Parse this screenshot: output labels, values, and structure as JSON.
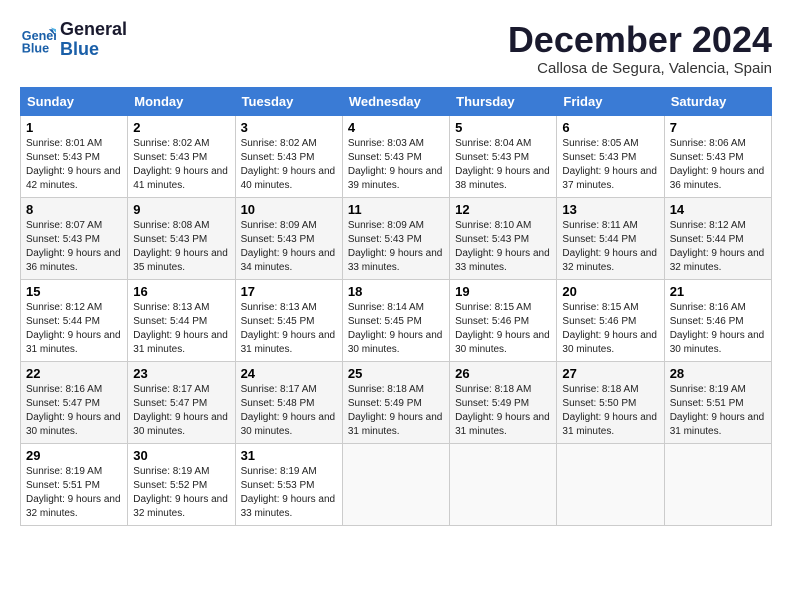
{
  "header": {
    "logo_line1": "General",
    "logo_line2": "Blue",
    "month": "December 2024",
    "location": "Callosa de Segura, Valencia, Spain"
  },
  "weekdays": [
    "Sunday",
    "Monday",
    "Tuesday",
    "Wednesday",
    "Thursday",
    "Friday",
    "Saturday"
  ],
  "weeks": [
    [
      {
        "day": "1",
        "sunrise": "Sunrise: 8:01 AM",
        "sunset": "Sunset: 5:43 PM",
        "daylight": "Daylight: 9 hours and 42 minutes."
      },
      {
        "day": "2",
        "sunrise": "Sunrise: 8:02 AM",
        "sunset": "Sunset: 5:43 PM",
        "daylight": "Daylight: 9 hours and 41 minutes."
      },
      {
        "day": "3",
        "sunrise": "Sunrise: 8:02 AM",
        "sunset": "Sunset: 5:43 PM",
        "daylight": "Daylight: 9 hours and 40 minutes."
      },
      {
        "day": "4",
        "sunrise": "Sunrise: 8:03 AM",
        "sunset": "Sunset: 5:43 PM",
        "daylight": "Daylight: 9 hours and 39 minutes."
      },
      {
        "day": "5",
        "sunrise": "Sunrise: 8:04 AM",
        "sunset": "Sunset: 5:43 PM",
        "daylight": "Daylight: 9 hours and 38 minutes."
      },
      {
        "day": "6",
        "sunrise": "Sunrise: 8:05 AM",
        "sunset": "Sunset: 5:43 PM",
        "daylight": "Daylight: 9 hours and 37 minutes."
      },
      {
        "day": "7",
        "sunrise": "Sunrise: 8:06 AM",
        "sunset": "Sunset: 5:43 PM",
        "daylight": "Daylight: 9 hours and 36 minutes."
      }
    ],
    [
      {
        "day": "8",
        "sunrise": "Sunrise: 8:07 AM",
        "sunset": "Sunset: 5:43 PM",
        "daylight": "Daylight: 9 hours and 36 minutes."
      },
      {
        "day": "9",
        "sunrise": "Sunrise: 8:08 AM",
        "sunset": "Sunset: 5:43 PM",
        "daylight": "Daylight: 9 hours and 35 minutes."
      },
      {
        "day": "10",
        "sunrise": "Sunrise: 8:09 AM",
        "sunset": "Sunset: 5:43 PM",
        "daylight": "Daylight: 9 hours and 34 minutes."
      },
      {
        "day": "11",
        "sunrise": "Sunrise: 8:09 AM",
        "sunset": "Sunset: 5:43 PM",
        "daylight": "Daylight: 9 hours and 33 minutes."
      },
      {
        "day": "12",
        "sunrise": "Sunrise: 8:10 AM",
        "sunset": "Sunset: 5:43 PM",
        "daylight": "Daylight: 9 hours and 33 minutes."
      },
      {
        "day": "13",
        "sunrise": "Sunrise: 8:11 AM",
        "sunset": "Sunset: 5:44 PM",
        "daylight": "Daylight: 9 hours and 32 minutes."
      },
      {
        "day": "14",
        "sunrise": "Sunrise: 8:12 AM",
        "sunset": "Sunset: 5:44 PM",
        "daylight": "Daylight: 9 hours and 32 minutes."
      }
    ],
    [
      {
        "day": "15",
        "sunrise": "Sunrise: 8:12 AM",
        "sunset": "Sunset: 5:44 PM",
        "daylight": "Daylight: 9 hours and 31 minutes."
      },
      {
        "day": "16",
        "sunrise": "Sunrise: 8:13 AM",
        "sunset": "Sunset: 5:44 PM",
        "daylight": "Daylight: 9 hours and 31 minutes."
      },
      {
        "day": "17",
        "sunrise": "Sunrise: 8:13 AM",
        "sunset": "Sunset: 5:45 PM",
        "daylight": "Daylight: 9 hours and 31 minutes."
      },
      {
        "day": "18",
        "sunrise": "Sunrise: 8:14 AM",
        "sunset": "Sunset: 5:45 PM",
        "daylight": "Daylight: 9 hours and 30 minutes."
      },
      {
        "day": "19",
        "sunrise": "Sunrise: 8:15 AM",
        "sunset": "Sunset: 5:46 PM",
        "daylight": "Daylight: 9 hours and 30 minutes."
      },
      {
        "day": "20",
        "sunrise": "Sunrise: 8:15 AM",
        "sunset": "Sunset: 5:46 PM",
        "daylight": "Daylight: 9 hours and 30 minutes."
      },
      {
        "day": "21",
        "sunrise": "Sunrise: 8:16 AM",
        "sunset": "Sunset: 5:46 PM",
        "daylight": "Daylight: 9 hours and 30 minutes."
      }
    ],
    [
      {
        "day": "22",
        "sunrise": "Sunrise: 8:16 AM",
        "sunset": "Sunset: 5:47 PM",
        "daylight": "Daylight: 9 hours and 30 minutes."
      },
      {
        "day": "23",
        "sunrise": "Sunrise: 8:17 AM",
        "sunset": "Sunset: 5:47 PM",
        "daylight": "Daylight: 9 hours and 30 minutes."
      },
      {
        "day": "24",
        "sunrise": "Sunrise: 8:17 AM",
        "sunset": "Sunset: 5:48 PM",
        "daylight": "Daylight: 9 hours and 30 minutes."
      },
      {
        "day": "25",
        "sunrise": "Sunrise: 8:18 AM",
        "sunset": "Sunset: 5:49 PM",
        "daylight": "Daylight: 9 hours and 31 minutes."
      },
      {
        "day": "26",
        "sunrise": "Sunrise: 8:18 AM",
        "sunset": "Sunset: 5:49 PM",
        "daylight": "Daylight: 9 hours and 31 minutes."
      },
      {
        "day": "27",
        "sunrise": "Sunrise: 8:18 AM",
        "sunset": "Sunset: 5:50 PM",
        "daylight": "Daylight: 9 hours and 31 minutes."
      },
      {
        "day": "28",
        "sunrise": "Sunrise: 8:19 AM",
        "sunset": "Sunset: 5:51 PM",
        "daylight": "Daylight: 9 hours and 31 minutes."
      }
    ],
    [
      {
        "day": "29",
        "sunrise": "Sunrise: 8:19 AM",
        "sunset": "Sunset: 5:51 PM",
        "daylight": "Daylight: 9 hours and 32 minutes."
      },
      {
        "day": "30",
        "sunrise": "Sunrise: 8:19 AM",
        "sunset": "Sunset: 5:52 PM",
        "daylight": "Daylight: 9 hours and 32 minutes."
      },
      {
        "day": "31",
        "sunrise": "Sunrise: 8:19 AM",
        "sunset": "Sunset: 5:53 PM",
        "daylight": "Daylight: 9 hours and 33 minutes."
      },
      null,
      null,
      null,
      null
    ]
  ]
}
